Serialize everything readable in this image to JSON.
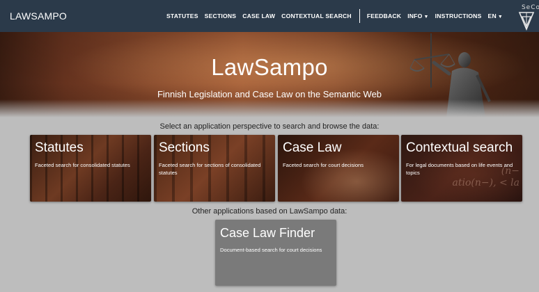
{
  "header": {
    "brand": "LAWSAMPO",
    "nav": {
      "statutes": "STATUTES",
      "sections": "SECTIONS",
      "case_law": "CASE LAW",
      "contextual_search": "CONTEXTUAL SEARCH",
      "feedback": "FEEDBACK",
      "info": "INFO",
      "instructions": "INSTRUCTIONS",
      "language": "EN"
    },
    "logo_text": "SeCo"
  },
  "hero": {
    "title": "LawSampo",
    "subtitle": "Finnish Legislation and Case Law on the Semantic Web"
  },
  "prompt": "Select an application perspective to search and browse the data:",
  "perspectives": [
    {
      "title": "Statutes",
      "description": "Faceted search for consolidated statutes"
    },
    {
      "title": "Sections",
      "description": "Faceted search for sections of consolidated statutes"
    },
    {
      "title": "Case Law",
      "description": "Faceted search for court decisions"
    },
    {
      "title": "Contextual search",
      "description": "For legal documents based on life events and topics"
    }
  ],
  "other_heading": "Other applications based on LawSampo data:",
  "other_apps": [
    {
      "title": "Case Law Finder",
      "description": "Document-based search for court decisions"
    }
  ],
  "colors": {
    "appbar": "#2b3a4a",
    "page_background": "#bdbdbd",
    "finder_card": "#7a7a7a"
  }
}
